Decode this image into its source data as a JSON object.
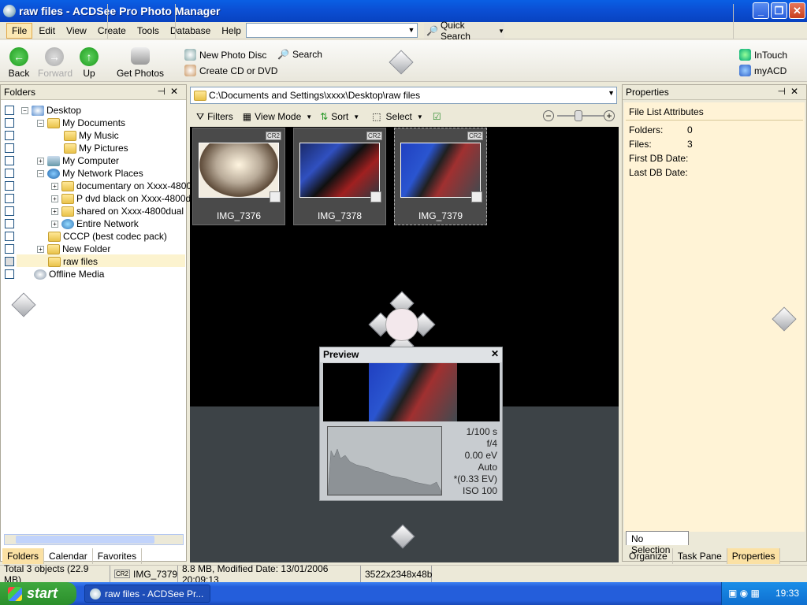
{
  "window": {
    "title": "raw files - ACDSee Pro Photo Manager"
  },
  "menu": {
    "items": [
      "File",
      "Edit",
      "View",
      "Create",
      "Tools",
      "Database",
      "Help"
    ],
    "quick_search": "Quick Search"
  },
  "toolbar": {
    "back": "Back",
    "forward": "Forward",
    "up": "Up",
    "get_photos": "Get Photos",
    "new_photo_disc": "New Photo Disc",
    "search": "Search",
    "create_cd": "Create CD or DVD",
    "intouch": "InTouch",
    "myacd": "myACD"
  },
  "folders": {
    "title": "Folders",
    "tree": [
      "Desktop",
      "My Documents",
      "My Music",
      "My Pictures",
      "My Computer",
      "My Network Places",
      "documentary on Xxxx-4800",
      "P dvd black on Xxxx-4800du",
      "shared on Xxxx-4800dual",
      "Entire Network",
      "CCCP (best codec pack)",
      "New Folder",
      "raw files",
      "Offline Media"
    ],
    "tabs": [
      "Folders",
      "Calendar",
      "Favorites"
    ]
  },
  "browser": {
    "path": "C:\\Documents and Settings\\xxxx\\Desktop\\raw files",
    "filters": "Filters",
    "view_mode": "View Mode",
    "sort": "Sort",
    "select": "Select",
    "thumbs": [
      {
        "name": "IMG_7376",
        "badge": "CR2"
      },
      {
        "name": "IMG_7378",
        "badge": "CR2"
      },
      {
        "name": "IMG_7379",
        "badge": "CR2"
      }
    ]
  },
  "preview": {
    "title": "Preview",
    "exif": [
      "1/100 s",
      "f/4",
      "0.00 eV",
      "Auto",
      "*(0.33 EV)",
      "ISO 100"
    ]
  },
  "properties": {
    "title": "Properties",
    "section": "File List Attributes",
    "rows": [
      {
        "label": "Folders:",
        "value": "0"
      },
      {
        "label": "Files:",
        "value": "3"
      },
      {
        "label": "First DB Date:",
        "value": ""
      },
      {
        "label": "Last DB Date:",
        "value": ""
      }
    ],
    "selection_tab": "No Selection",
    "tabs": [
      "Organize",
      "Task Pane",
      "Properties"
    ]
  },
  "status": {
    "total": "Total 3 objects  (22.9 MB)",
    "file": "IMG_7379",
    "badge": "CR2",
    "info": "8.8 MB, Modified Date: 13/01/2006 20:09:13",
    "dims": "3522x2348x48b"
  },
  "taskbar": {
    "start": "start",
    "task": "raw files - ACDSee Pr...",
    "clock": "19:33"
  },
  "colors": {
    "title_blue": "#0b4fd4",
    "selected_tab": "#fbe1a4",
    "gallery_bg": "#000000"
  }
}
